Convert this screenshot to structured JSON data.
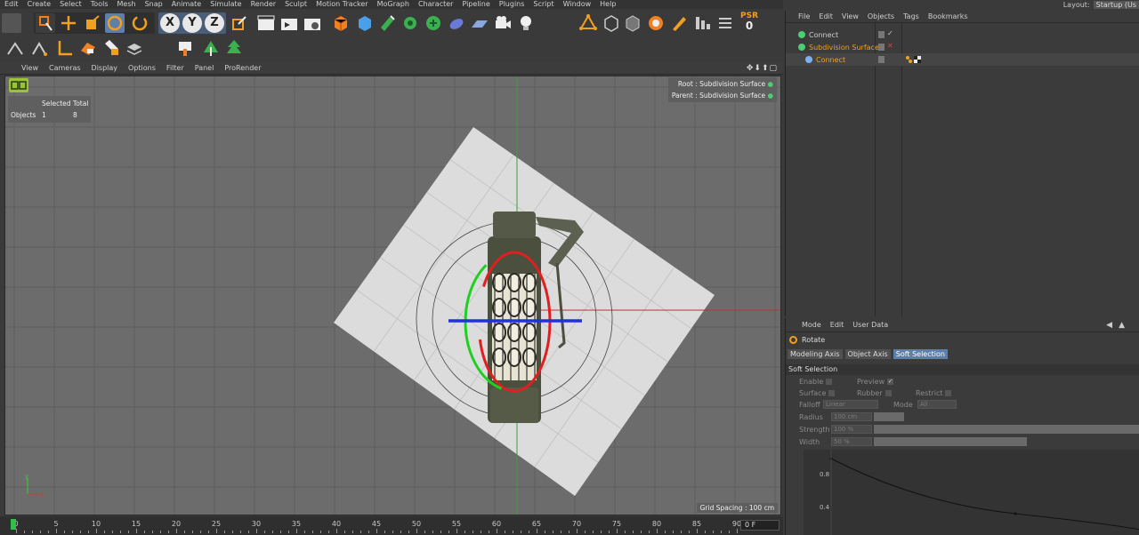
{
  "menu": {
    "items": [
      "Edit",
      "Create",
      "Select",
      "Tools",
      "Mesh",
      "Snap",
      "Animate",
      "Simulate",
      "Render",
      "Sculpt",
      "Motion Tracker",
      "MoGraph",
      "Character",
      "Pipeline",
      "Plugins",
      "Script",
      "Window",
      "Help"
    ],
    "layout_label": "Layout:",
    "layout_value": "Startup (Us"
  },
  "toolbar": {
    "axis_x": "X",
    "axis_y": "Y",
    "axis_z": "Z",
    "psr_label": "PSR",
    "psr_value": "0"
  },
  "viewport": {
    "menu": [
      "View",
      "Cameras",
      "Display",
      "Options",
      "Filter",
      "Panel",
      "ProRender"
    ],
    "nav_icons": "✥⬇⬆▢",
    "stats_header": "Selected Total",
    "stats_row_label": "Objects",
    "stats_selected": "1",
    "stats_total": "8",
    "root_label": "Root : Subdivision Surface",
    "parent_label": "Parent : Subdivision Surface",
    "grid_spacing": "Grid Spacing : 100 cm",
    "axis_y_label": "y",
    "axis_x_label": "x"
  },
  "timeline": {
    "ticks": [
      "0",
      "5",
      "10",
      "15",
      "20",
      "25",
      "30",
      "35",
      "40",
      "45",
      "50",
      "55",
      "60",
      "65",
      "70",
      "75",
      "80",
      "85",
      "90"
    ],
    "current_frame": "0 F"
  },
  "object_manager": {
    "menu": [
      "File",
      "Edit",
      "View",
      "Objects",
      "Tags",
      "Bookmarks"
    ],
    "objects": [
      {
        "name": "Connect",
        "color": "#cfcfcf"
      },
      {
        "name": "Subdivision Surface",
        "color": "#f0a020"
      },
      {
        "name": "Connect",
        "color": "#f0a020"
      }
    ]
  },
  "attribute_manager": {
    "menu": [
      "Mode",
      "Edit",
      "User Data"
    ],
    "title": "Rotate",
    "tabs": [
      "Modeling Axis",
      "Object Axis",
      "Soft Selection"
    ],
    "active_tab": "Soft Selection",
    "section": "Soft Selection",
    "props": {
      "enable": "Enable",
      "preview": "Preview",
      "preview_check": "✓",
      "surface": "Surface",
      "rubber": "Rubber",
      "restrict": "Restrict",
      "falloff": "Falloff",
      "falloff_value": "Linear",
      "mode": "Mode",
      "mode_value": "All",
      "radius": "Radius",
      "radius_value": "100 cm",
      "strength": "Strength",
      "strength_value": "100 %",
      "width": "Width",
      "width_value": "50 %"
    },
    "curve_labels": [
      "0.8",
      "0.4"
    ]
  }
}
